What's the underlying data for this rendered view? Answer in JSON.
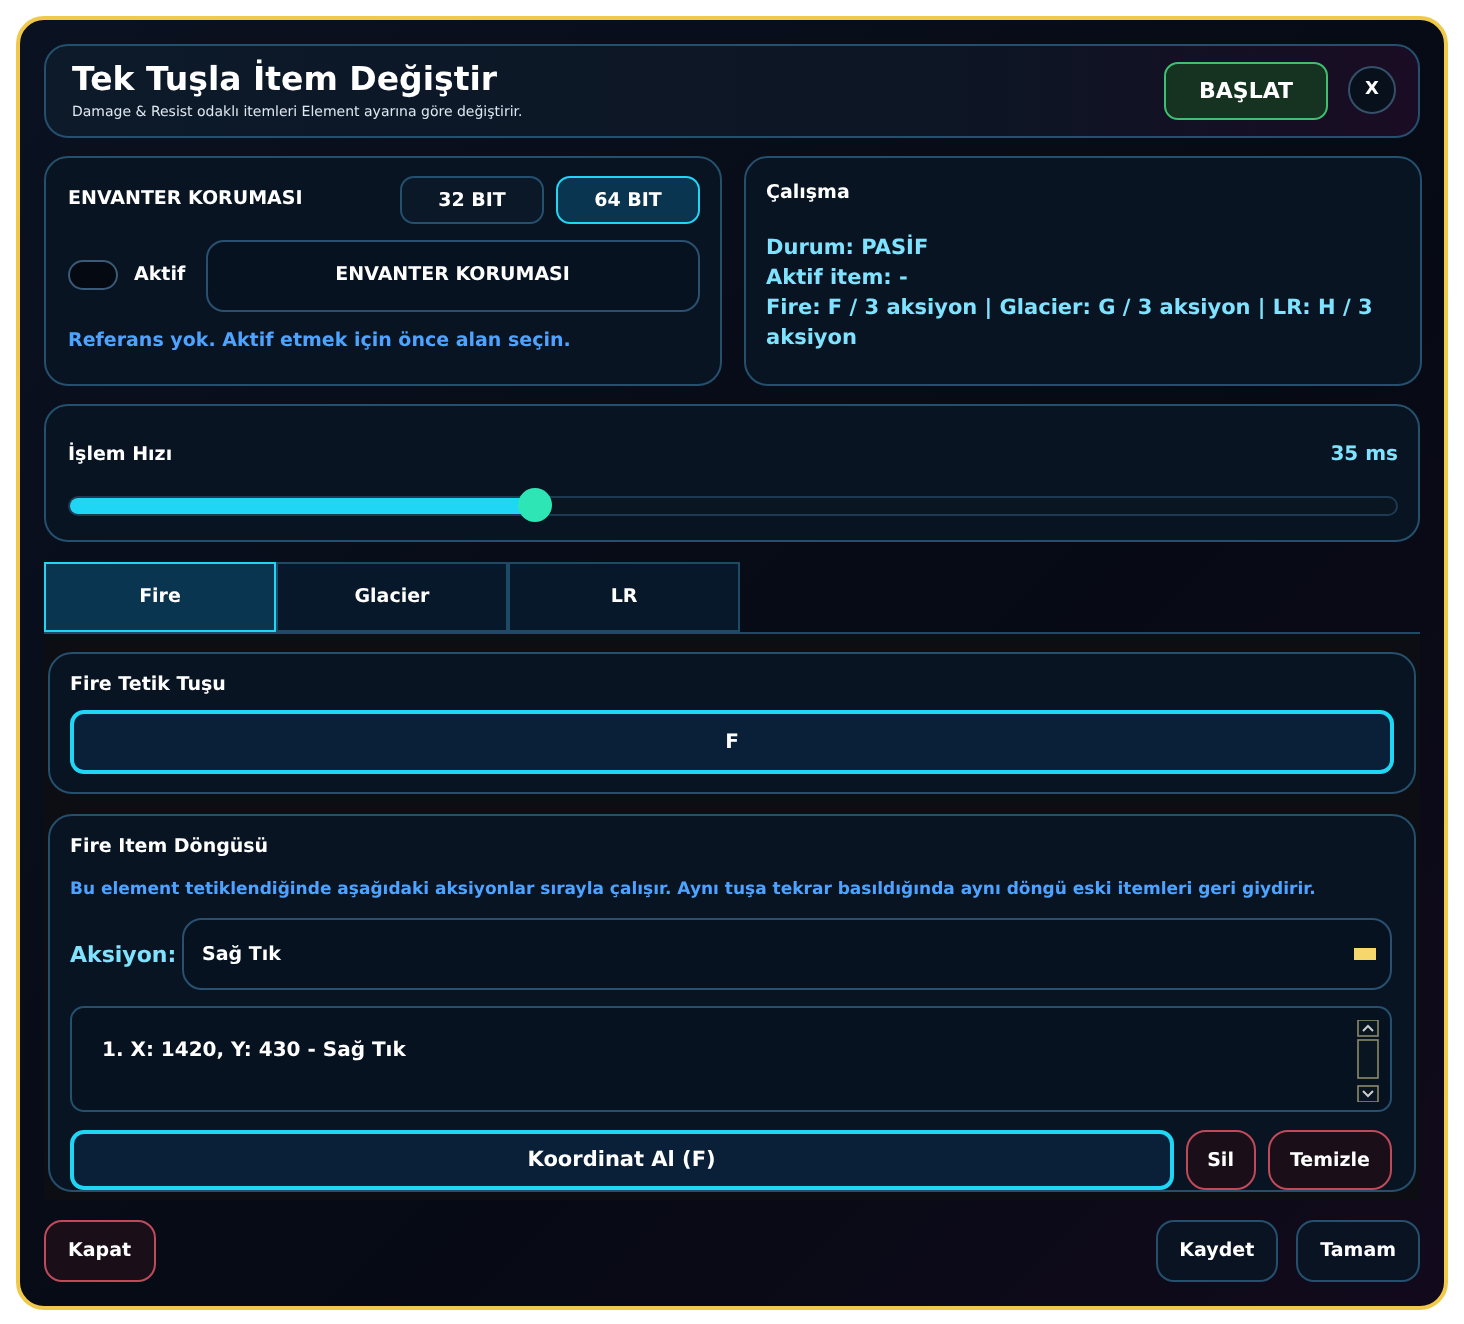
{
  "header": {
    "title": "Tek Tuşla İtem Değiştir",
    "subtitle": "Damage & Resist odaklı itemleri Element ayarına göre değiştirir.",
    "start_button": "BAŞLAT",
    "close_button": "X"
  },
  "protection": {
    "title": "ENVANTER KORUMASI",
    "bit_options": [
      {
        "label": "32 BIT",
        "selected": false
      },
      {
        "label": "64 BIT",
        "selected": true
      }
    ],
    "toggle": {
      "label": "Aktif",
      "on": false
    },
    "button": "ENVANTER KORUMASI",
    "hint": "Referans yok. Aktif etmek için önce alan seçin."
  },
  "status": {
    "title": "Çalışma",
    "lines": [
      "Durum: PASİF",
      "Aktif item: -",
      "Fire: F / 3 aksiyon | Glacier: G / 3 aksiyon | LR: H / 3 aksiyon"
    ]
  },
  "speed": {
    "label": "İşlem Hızı",
    "reading": "35 ms",
    "level": 0.35
  },
  "tabs": [
    {
      "label": "Fire",
      "selected": true
    },
    {
      "label": "Glacier",
      "selected": false
    },
    {
      "label": "LR",
      "selected": false
    }
  ],
  "trigger": {
    "title": "Fire Tetik Tuşu",
    "key": "F"
  },
  "cycle": {
    "title": "Fire Item Döngüsü",
    "description": "Bu element tetiklendiğinde aşağıdaki aksiyonlar sırayla çalışır. Aynı tuşa tekrar basıldığında aynı döngü eski itemleri geri giydirir.",
    "action_label": "Aksiyon:",
    "action_value": "Sağ Tık",
    "steps": [
      "1. X: 1420, Y: 430 - Sağ Tık"
    ],
    "capture_button": "Koordinat Al (F)",
    "delete_button": "Sil",
    "clear_button": "Temizle"
  },
  "footer": {
    "close_button": "Kapat",
    "save_button": "Kaydet",
    "ok_button": "Tamam"
  }
}
